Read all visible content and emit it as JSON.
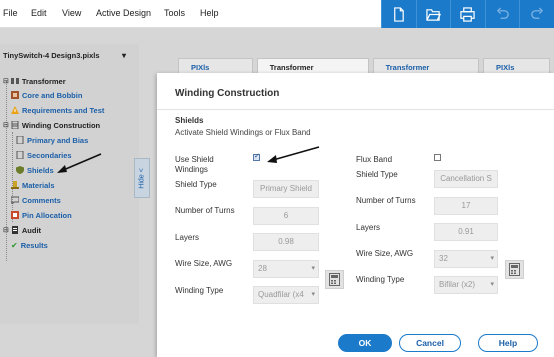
{
  "menu": {
    "items": [
      "File",
      "Edit",
      "View",
      "Active Design",
      "Tools",
      "Help"
    ]
  },
  "toolbar": {
    "buttons": [
      "new-file-icon",
      "open-folder-icon",
      "print-icon",
      "undo-icon",
      "redo-icon"
    ],
    "accent": "#1b7ac9"
  },
  "project": {
    "name": "TinySwitch-4 Design3.pixls"
  },
  "tree": {
    "transformer": "Transformer",
    "core_bobbin": "Core and Bobbin",
    "requirements": "Requirements and Test",
    "winding_construction": "Winding Construction",
    "primary_bias": "Primary and Bias",
    "secondaries": "Secondaries",
    "shields": "Shields",
    "materials": "Materials",
    "comments": "Comments",
    "pin_allocation": "Pin Allocation",
    "audit": "Audit",
    "results": "Results"
  },
  "hide_tab": "Hide <",
  "tabs": [
    "PIXls Designer",
    "Transformer Construction",
    "Transformer Parameters",
    "PIXls Charts"
  ],
  "dialog": {
    "title": "Winding Construction",
    "section_title": "Shields",
    "section_subtitle": "Activate Shield Windings or Flux Band",
    "left": {
      "use_shield_label": "Use Shield Windings",
      "use_shield_checked": true,
      "shield_type_label": "Shield Type",
      "shield_type_value": "Primary Shield",
      "turns_label": "Number of Turns",
      "turns_value": "6",
      "layers_label": "Layers",
      "layers_value": "0.98",
      "wire_label": "Wire Size, AWG",
      "wire_value": "28",
      "winding_type_label": "Winding Type",
      "winding_type_value": "Quadfilar (x4"
    },
    "right": {
      "flux_band_label": "Flux Band",
      "flux_band_checked": false,
      "shield_type_label": "Shield Type",
      "shield_type_value": "Cancellation S",
      "turns_label": "Number of Turns",
      "turns_value": "17",
      "layers_label": "Layers",
      "layers_value": "0.91",
      "wire_label": "Wire Size, AWG",
      "wire_value": "32",
      "winding_type_label": "Winding Type",
      "winding_type_value": "Bifilar (x2)"
    },
    "buttons": {
      "ok": "OK",
      "cancel": "Cancel",
      "help": "Help"
    }
  }
}
